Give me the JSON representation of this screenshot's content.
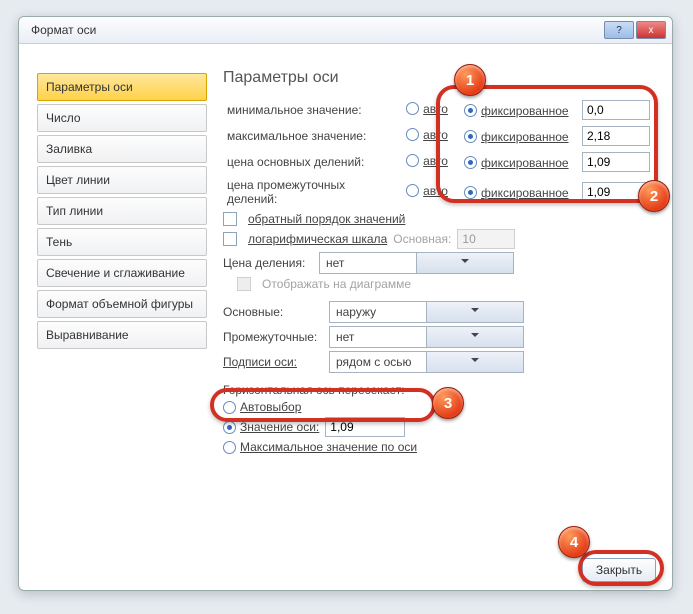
{
  "window": {
    "title": "Формат оси",
    "help": "?",
    "close": "x"
  },
  "sidebar": {
    "items": [
      "Параметры оси",
      "Число",
      "Заливка",
      "Цвет линии",
      "Тип линии",
      "Тень",
      "Свечение и сглаживание",
      "Формат объемной фигуры",
      "Выравнивание"
    ]
  },
  "main": {
    "heading": "Параметры оси",
    "rows": {
      "min_label": "минимальное значение:",
      "max_label": "максимальное значение:",
      "major_label": "цена основных делений:",
      "minor_label": "цена промежуточных делений:",
      "auto": "авто",
      "fixed": "фиксированное",
      "min_val": "0,0",
      "max_val": "2,18",
      "major_val": "1,09",
      "minor_val": "1,09"
    },
    "checks": {
      "reverse": "обратный порядок значений",
      "log": "логарифмическая шкала",
      "base_label": "Основная:",
      "base_val": "10",
      "show_on_chart": "Отображать на диаграмме"
    },
    "unit": {
      "label": "Цена деления:",
      "value": "нет"
    },
    "ticks": {
      "major_label": "Основные:",
      "major_val": "наружу",
      "minor_label": "Промежуточные:",
      "minor_val": "нет",
      "axis_labels": "Подписи оси:",
      "axis_labels_val": "рядом с осью"
    },
    "cross": {
      "title": "Горизонтальная ось пересекает:",
      "auto": "Автовыбор",
      "value_label": "Значение оси:",
      "value": "1,09",
      "max": "Максимальное значение по оси"
    }
  },
  "footer": {
    "close": "Закрыть"
  },
  "badges": {
    "b1": "1",
    "b2": "2",
    "b3": "3",
    "b4": "4"
  }
}
